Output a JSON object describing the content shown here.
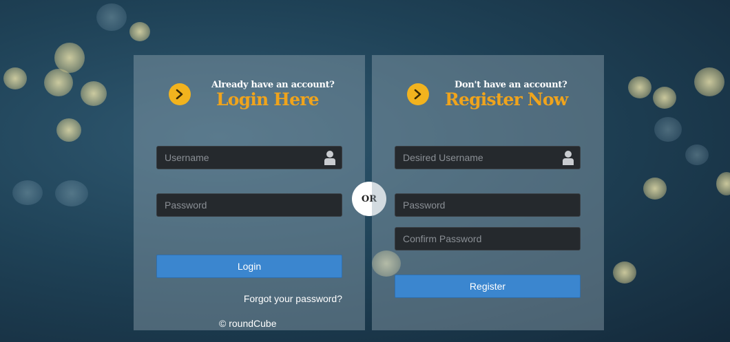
{
  "login": {
    "subtitle": "Already have an account?",
    "title": "Login Here",
    "username_placeholder": "Username",
    "password_placeholder": "Password",
    "button_label": "Login",
    "forgot_label": "Forgot your password?",
    "copyright": "© roundCube"
  },
  "divider": {
    "label": "OR"
  },
  "register": {
    "subtitle": "Don't have an account?",
    "title": "Register Now",
    "username_placeholder": "Desired Username",
    "password_placeholder": "Password",
    "confirm_placeholder": "Confirm Password",
    "button_label": "Register"
  },
  "icons": {
    "arrow": "chevron-right-icon",
    "user": "user-icon"
  },
  "colors": {
    "accent": "#f0a41c",
    "button": "#3b86cf",
    "field_bg": "#25292d"
  }
}
